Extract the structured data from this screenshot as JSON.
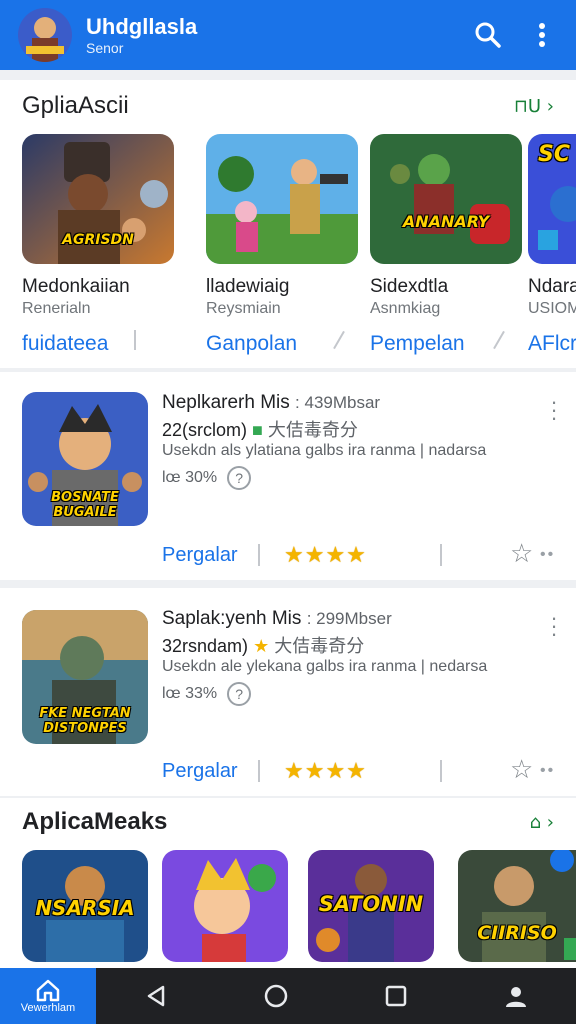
{
  "appbar": {
    "title": "Uhdgllasla",
    "subtitle": "Senor",
    "search_icon": "search-icon",
    "menu_icon": "more-vert-icon"
  },
  "section_featured": {
    "title": "GpliaAscii",
    "more": "⊓U ›",
    "games": [
      {
        "name": "Medonkaiian",
        "sub": "Renerialn",
        "action": "fuidateea",
        "banner": "AGRISDN"
      },
      {
        "name": "lladewiaig",
        "sub": "Reysmiain",
        "action": "Ganpolan",
        "banner": ""
      },
      {
        "name": "Sidexdtla",
        "sub": "Asnmkiag",
        "action": "Pempelan",
        "banner": "ANANARY"
      },
      {
        "name": "Ndara",
        "sub": "USIOM",
        "action": "AFlcr",
        "banner": "SC"
      }
    ]
  },
  "list": [
    {
      "name": "Neplkarerh Mis",
      "size": ": 439Mbsar",
      "line2_prefix": "22(srclom)",
      "line2_text": "大佶毒奇分",
      "desc": "Usekdn als ylatiana galbs ira ranma | nadarsa",
      "pct": "lœ 30%",
      "help": "?",
      "action": "Pergalar",
      "stars": "★★★★",
      "banner": "BOSNATE BUGAILE"
    },
    {
      "name": "Saplak:yenh Mis",
      "size": ": 299Mbser",
      "line2_prefix": "32rsndam)",
      "line2_text": "大佶毒奇分",
      "desc": "Usekdn ale ylekana galbs ira ranma | nedarsa",
      "pct": "lœ 33%",
      "help": "?",
      "action": "Pergalar",
      "stars": "★★★★",
      "banner": "FKE NEGTAN DISTONPES"
    }
  ],
  "section_apps": {
    "title": "AplicaMeaks",
    "more": "⌂ ›",
    "banners": [
      "NSARSIA",
      "",
      "SATONIN",
      "CIIRISO"
    ]
  },
  "navbar": {
    "home_label": "Vewerhlam"
  },
  "colors": {
    "primary": "#1a73e8",
    "star": "#f4b400",
    "accent_green": "#188038"
  }
}
